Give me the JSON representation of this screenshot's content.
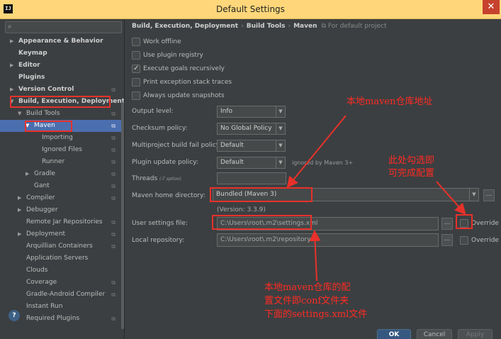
{
  "window": {
    "title": "Default Settings",
    "app_icon": "IJ"
  },
  "sidebar": {
    "search_placeholder": "",
    "items": [
      {
        "label": "Appearance & Behavior"
      },
      {
        "label": "Keymap"
      },
      {
        "label": "Editor"
      },
      {
        "label": "Plugins"
      },
      {
        "label": "Version Control"
      },
      {
        "label": "Build, Execution, Deployment"
      },
      {
        "label": "Build Tools"
      },
      {
        "label": "Maven"
      },
      {
        "label": "Importing"
      },
      {
        "label": "Ignored Files"
      },
      {
        "label": "Runner"
      },
      {
        "label": "Gradle"
      },
      {
        "label": "Gant"
      },
      {
        "label": "Compiler"
      },
      {
        "label": "Debugger"
      },
      {
        "label": "Remote Jar Repositories"
      },
      {
        "label": "Deployment"
      },
      {
        "label": "Arquillian Containers"
      },
      {
        "label": "Application Servers"
      },
      {
        "label": "Clouds"
      },
      {
        "label": "Coverage"
      },
      {
        "label": "Gradle-Android Compiler"
      },
      {
        "label": "Instant Run"
      },
      {
        "label": "Required Plugins"
      }
    ]
  },
  "breadcrumb": {
    "part1": "Build, Execution, Deployment",
    "part2": "Build Tools",
    "part3": "Maven",
    "project_note": "For default project"
  },
  "checkboxes": [
    {
      "label": "Work offline",
      "checked": false
    },
    {
      "label": "Use plugin registry",
      "checked": false
    },
    {
      "label": "Execute goals recursively",
      "checked": true
    },
    {
      "label": "Print exception stack traces",
      "checked": false
    },
    {
      "label": "Always update snapshots",
      "checked": false
    }
  ],
  "form": {
    "output_level": {
      "label": "Output level:",
      "value": "Info"
    },
    "checksum_policy": {
      "label": "Checksum policy:",
      "value": "No Global Policy"
    },
    "multiproject_fail": {
      "label": "Multiproject build fail policy:",
      "value": "Default"
    },
    "plugin_update": {
      "label": "Plugin update policy:",
      "value": "Default",
      "hint": "ignored by Maven 3+"
    },
    "threads": {
      "label": "Threads",
      "hint": "(-T option)",
      "value": ""
    },
    "maven_home": {
      "label": "Maven home directory:",
      "value": "Bundled (Maven 3)",
      "version": "(Version: 3.3.9)"
    },
    "user_settings": {
      "label": "User settings file:",
      "value": "C:\\Users\\root\\.m2\\settings.xml",
      "override": "Override"
    },
    "local_repo": {
      "label": "Local repository:",
      "value": "C:\\Users\\root\\.m2\\repository",
      "override": "Override"
    }
  },
  "buttons": {
    "ok": "OK",
    "cancel": "Cancel",
    "apply": "Apply",
    "browse": "...",
    "help": "?"
  },
  "annotations": {
    "maven_home_note": "本地maven仓库地址",
    "override_note_1": "此处勾选即",
    "override_note_2": "可完成配置",
    "settings_note_1": "本地maven仓库的配",
    "settings_note_2": "置文件即conf文件夹",
    "settings_note_3": "下面的settings.xml文件"
  },
  "colors": {
    "annotation": "#e8312a",
    "selection": "#4b6eaf",
    "titlebar": "#ffd77a"
  }
}
